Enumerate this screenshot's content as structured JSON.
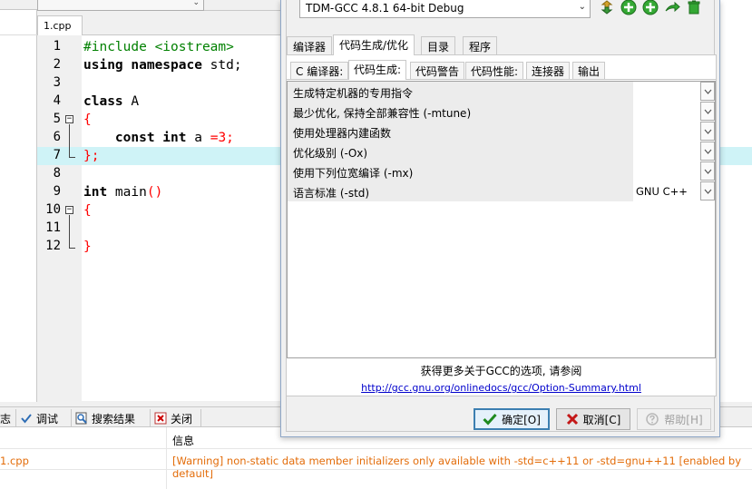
{
  "editor": {
    "file_tab": "1.cpp",
    "lines": [
      {
        "no": "1",
        "parts": [
          {
            "t": "#include <iostream>",
            "c": "green"
          }
        ]
      },
      {
        "no": "2",
        "parts": [
          {
            "t": "using namespace",
            "c": "kw"
          },
          {
            "t": " std;",
            "c": "plain"
          }
        ]
      },
      {
        "no": "3",
        "parts": []
      },
      {
        "no": "4",
        "parts": [
          {
            "t": "class",
            "c": "kw"
          },
          {
            "t": " A",
            "c": "plain"
          }
        ]
      },
      {
        "no": "5",
        "parts": [
          {
            "t": "{",
            "c": "red"
          }
        ]
      },
      {
        "no": "6",
        "parts": [
          {
            "t": "    ",
            "c": "plain"
          },
          {
            "t": "const int",
            "c": "kw"
          },
          {
            "t": " a ",
            "c": "plain"
          },
          {
            "t": "=",
            "c": "red"
          },
          {
            "t": "3",
            "c": "num"
          },
          {
            "t": ";",
            "c": "red"
          }
        ]
      },
      {
        "no": "7",
        "parts": [
          {
            "t": "};",
            "c": "red"
          }
        ]
      },
      {
        "no": "8",
        "parts": []
      },
      {
        "no": "9",
        "parts": [
          {
            "t": "int",
            "c": "kw"
          },
          {
            "t": " main",
            "c": "plain"
          },
          {
            "t": "()",
            "c": "red"
          }
        ]
      },
      {
        "no": "10",
        "parts": [
          {
            "t": "{",
            "c": "red"
          }
        ]
      },
      {
        "no": "11",
        "parts": []
      },
      {
        "no": "12",
        "parts": [
          {
            "t": "}",
            "c": "red"
          }
        ]
      }
    ]
  },
  "bottom_tabs": {
    "partial": "志",
    "debug": "调试",
    "search_results": "搜索结果",
    "close": "关闭"
  },
  "results": {
    "col_info": "信息",
    "row1_file": "1.cpp",
    "row1_msg": "[Warning] non-static data member initializers only available with -std=c++11 or -std=gnu++11 [enabled by default]"
  },
  "dialog": {
    "compiler_select": "TDM-GCC 4.8.1 64-bit Debug",
    "main_tabs": [
      "编译器",
      "代码生成/优化",
      "目录",
      "程序"
    ],
    "sub_tabs": [
      "C 编译器:",
      "代码生成:",
      "代码警告",
      "代码性能:",
      "连接器",
      "输出"
    ],
    "options": [
      {
        "label": "生成特定机器的专用指令",
        "value": ""
      },
      {
        "label": "最少优化, 保持全部兼容性 (-mtune)",
        "value": ""
      },
      {
        "label": "使用处理器内建函数",
        "value": ""
      },
      {
        "label": "优化级别 (-Ox)",
        "value": ""
      },
      {
        "label": "使用下列位宽编译 (-mx)",
        "value": ""
      },
      {
        "label": "语言标准 (-std)",
        "value": "GNU C++"
      }
    ],
    "more_text": "获得更多关于GCC的选项, 请参阅",
    "more_link": "http://gcc.gnu.org/onlinedocs/gcc/Option-Summary.html",
    "ok": "确定[O]",
    "cancel": "取消[C]",
    "help": "帮助[H]"
  },
  "colors": {
    "comment_green": "#008000",
    "brace_red": "#ff0000",
    "highlight_cyan": "#cff3f7",
    "warning_orange": "#e36c09",
    "link_blue": "#0000cc"
  }
}
